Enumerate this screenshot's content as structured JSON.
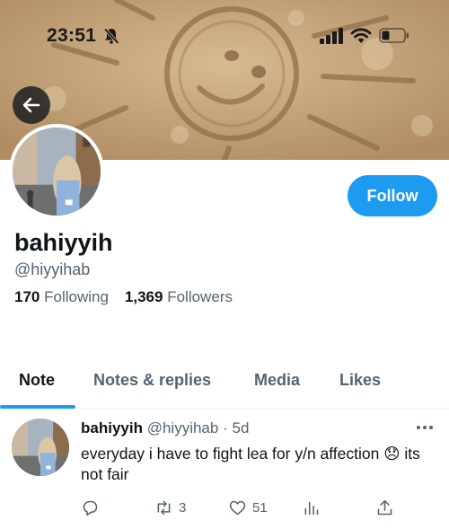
{
  "status_bar": {
    "time": "23:51"
  },
  "profile": {
    "display_name": "bahiyyih",
    "handle": "@hiyyihab",
    "following_count": "170",
    "following_label": "Following",
    "followers_count": "1,369",
    "followers_label": "Followers",
    "follow_label": "Follow"
  },
  "tabs": [
    {
      "label": "Note",
      "active": true
    },
    {
      "label": "Notes & replies",
      "active": false
    },
    {
      "label": "Media",
      "active": false
    },
    {
      "label": "Likes",
      "active": false
    }
  ],
  "tweet": {
    "name": "bahiyyih",
    "handle": "@hiyyihab",
    "age": "5d",
    "separator": "·",
    "text": "everyday i have to fight lea for y/n affection 😞 its not fair",
    "retweets": "3",
    "likes": "51"
  },
  "icons": [
    "bell-slash-icon",
    "signal-icon",
    "wifi-icon",
    "battery-icon",
    "back-arrow-icon",
    "more-icon",
    "reply-icon",
    "retweet-icon",
    "like-icon",
    "views-icon",
    "share-icon"
  ],
  "colors": {
    "accent": "#1d9bf0",
    "text_primary": "#0f1419",
    "text_secondary": "#536471"
  }
}
